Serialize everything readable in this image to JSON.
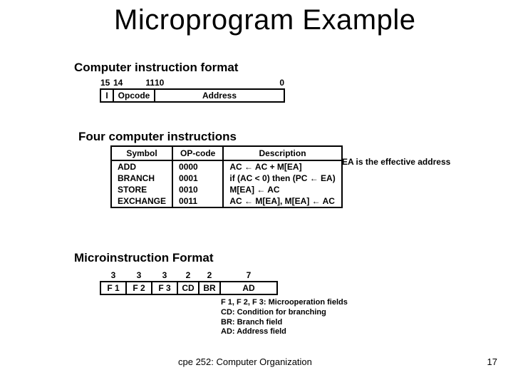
{
  "title": "Microprogram Example",
  "sec1": "Computer instruction format",
  "sec2": "Four computer instructions",
  "sec3": "Microinstruction Format",
  "fmt1": {
    "bits": {
      "b15": "15",
      "b14": "14",
      "b11": "11",
      "b10": "10",
      "b0": "0"
    },
    "fields": {
      "I": "I",
      "Opcode": "Opcode",
      "Address": "Address"
    }
  },
  "tbl": {
    "head": {
      "symbol": "Symbol",
      "opcode": "OP-code",
      "desc": "Description"
    },
    "rows": [
      {
        "symbol": "ADD",
        "opcode": "0000",
        "desc": "AC ← AC + M[EA]"
      },
      {
        "symbol": "BRANCH",
        "opcode": "0001",
        "desc": "if (AC < 0) then (PC ← EA)"
      },
      {
        "symbol": "STORE",
        "opcode": "0010",
        "desc": "M[EA] ← AC"
      },
      {
        "symbol": "EXCHANGE",
        "opcode": "0011",
        "desc": "AC ← M[EA], M[EA] ← AC"
      }
    ]
  },
  "eanote": "EA is the effective address",
  "fmt2": {
    "bits": {
      "a": "3",
      "b": "3",
      "c": "3",
      "d": "2",
      "e": "2",
      "f": "7"
    },
    "fields": {
      "F1": "F 1",
      "F2": "F 2",
      "F3": "F 3",
      "CD": "CD",
      "BR": "BR",
      "AD": "AD"
    }
  },
  "legend": {
    "l1": "F 1, F 2, F 3: Microoperation fields",
    "l2": "CD: Condition for branching",
    "l3": "BR: Branch field",
    "l4": "AD: Address field"
  },
  "footer": "cpe 252: Computer Organization",
  "page": "17"
}
